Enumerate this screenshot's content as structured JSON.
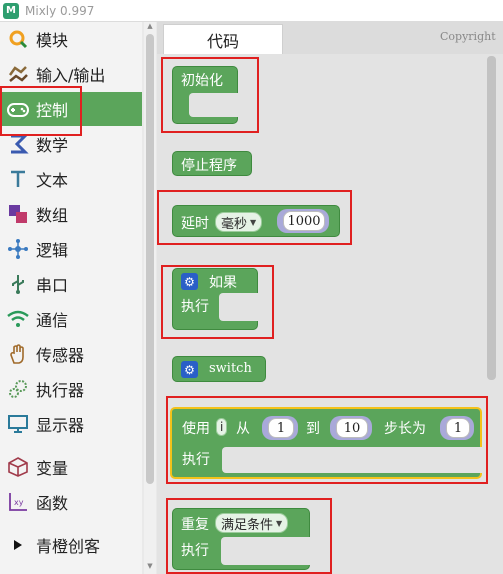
{
  "window": {
    "title": "Mixly 0.997",
    "logo_letter": "M"
  },
  "sidebar": {
    "items": [
      {
        "label": "模块",
        "icon": "search-icon",
        "selected": false
      },
      {
        "label": "输入/输出",
        "icon": "input-output-icon",
        "selected": false
      },
      {
        "label": "控制",
        "icon": "gamepad-icon",
        "selected": true
      },
      {
        "label": "数学",
        "icon": "sigma-icon",
        "selected": false
      },
      {
        "label": "文本",
        "icon": "text-t-icon",
        "selected": false
      },
      {
        "label": "数组",
        "icon": "array-icon",
        "selected": false
      },
      {
        "label": "逻辑",
        "icon": "network-icon",
        "selected": false
      },
      {
        "label": "串口",
        "icon": "usb-icon",
        "selected": false
      },
      {
        "label": "通信",
        "icon": "wifi-icon",
        "selected": false
      },
      {
        "label": "传感器",
        "icon": "hand-icon",
        "selected": false
      },
      {
        "label": "执行器",
        "icon": "gears-icon",
        "selected": false
      },
      {
        "label": "显示器",
        "icon": "monitor-icon",
        "selected": false
      },
      {
        "label": "变量",
        "icon": "cube-icon",
        "selected": false
      },
      {
        "label": "函数",
        "icon": "function-icon",
        "selected": false
      },
      {
        "label": "青橙创客",
        "icon": "triangle-right-icon",
        "selected": false
      }
    ]
  },
  "tabs": {
    "code": "代码"
  },
  "copyright": "Copyright",
  "blocks": {
    "setup": {
      "label": "初始化"
    },
    "stop": {
      "label": "停止程序"
    },
    "delay": {
      "label": "延时",
      "unit": "毫秒",
      "value": "1000"
    },
    "if": {
      "label": "如果",
      "do": "执行"
    },
    "switch": {
      "label": "switch"
    },
    "for": {
      "use": "使用",
      "var": "i",
      "from": "从",
      "from_value": "1",
      "to": "到",
      "to_value": "10",
      "step_label": "步长为",
      "step_value": "1",
      "do": "执行"
    },
    "repeat": {
      "label": "重复",
      "mode": "满足条件",
      "do": "执行"
    }
  },
  "colors": {
    "block_green": "#5ba55b",
    "highlight_red": "#e02020",
    "mutator_blue": "#2a5fc7"
  }
}
